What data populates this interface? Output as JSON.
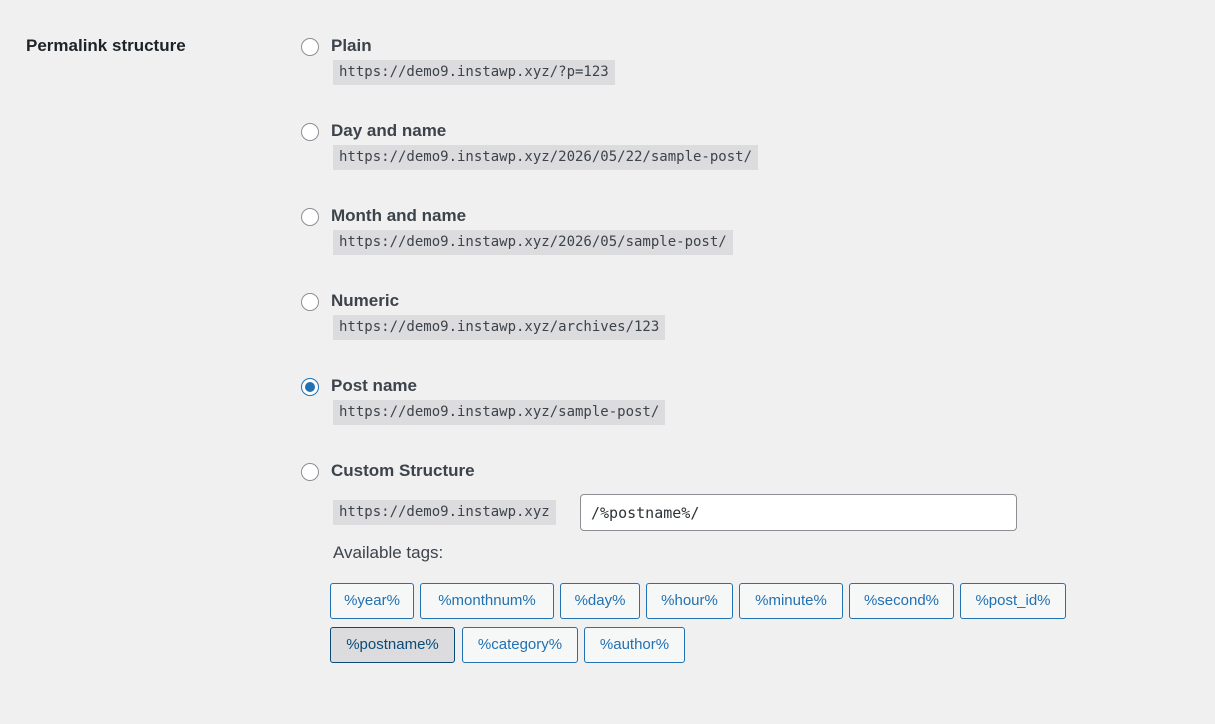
{
  "section": {
    "label": "Permalink structure"
  },
  "options": [
    {
      "label": "Plain",
      "example": "https://demo9.instawp.xyz/?p=123",
      "checked": false
    },
    {
      "label": "Day and name",
      "example": "https://demo9.instawp.xyz/2026/05/22/sample-post/",
      "checked": false
    },
    {
      "label": "Month and name",
      "example": "https://demo9.instawp.xyz/2026/05/sample-post/",
      "checked": false
    },
    {
      "label": "Numeric",
      "example": "https://demo9.instawp.xyz/archives/123",
      "checked": false
    },
    {
      "label": "Post name",
      "example": "https://demo9.instawp.xyz/sample-post/",
      "checked": true
    },
    {
      "label": "Custom Structure",
      "checked": false
    }
  ],
  "custom": {
    "prefix": "https://demo9.instawp.xyz",
    "value": "/%postname%/"
  },
  "tags": {
    "label": "Available tags:",
    "items": [
      {
        "label": "%year%",
        "active": false
      },
      {
        "label": "%monthnum%",
        "active": false
      },
      {
        "label": "%day%",
        "active": false
      },
      {
        "label": "%hour%",
        "active": false
      },
      {
        "label": "%minute%",
        "active": false
      },
      {
        "label": "%second%",
        "active": false
      },
      {
        "label": "%post_id%",
        "active": false
      },
      {
        "label": "%postname%",
        "active": true
      },
      {
        "label": "%category%",
        "active": false
      },
      {
        "label": "%author%",
        "active": false
      }
    ]
  },
  "colors": {
    "accent": "#2271b1",
    "background": "#f0f0f1"
  }
}
